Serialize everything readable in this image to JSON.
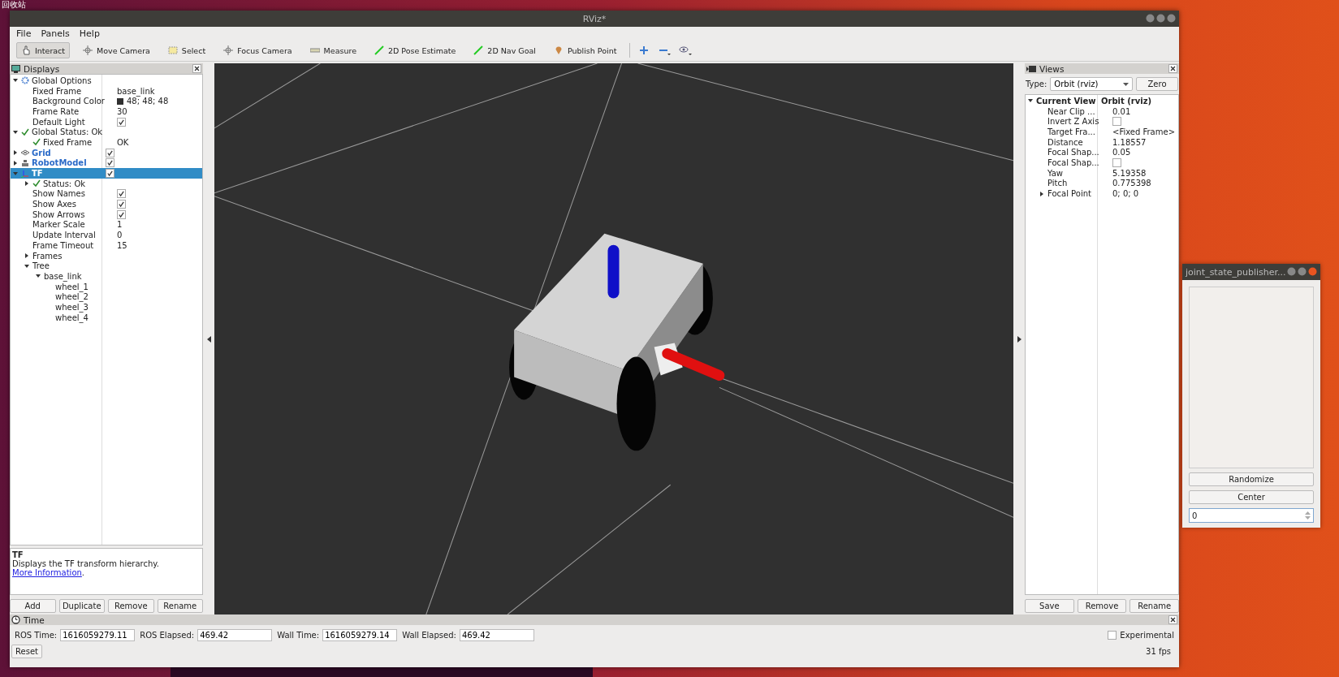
{
  "desktop": {
    "trash_label": "回收站"
  },
  "window": {
    "title": "RViz*"
  },
  "menu": [
    {
      "label": "File"
    },
    {
      "label": "Panels"
    },
    {
      "label": "Help"
    }
  ],
  "tools": [
    {
      "label": "Interact",
      "kind": "interact",
      "selected": true
    },
    {
      "label": "Move Camera",
      "kind": "move",
      "selected": false
    },
    {
      "label": "Select",
      "kind": "select",
      "selected": false
    },
    {
      "label": "Focus Camera",
      "kind": "focus",
      "selected": false
    },
    {
      "label": "Measure",
      "kind": "measure",
      "selected": false
    },
    {
      "label": "2D Pose Estimate",
      "kind": "pose",
      "selected": false
    },
    {
      "label": "2D Nav Goal",
      "kind": "goal",
      "selected": false
    },
    {
      "label": "Publish Point",
      "kind": "point",
      "selected": false
    }
  ],
  "displays": {
    "title": "Displays",
    "tree": [
      {
        "label": "Global Options",
        "kind": "options",
        "expanded": true,
        "selected": false,
        "children": [
          {
            "label": "Fixed Frame",
            "value": "base_link"
          },
          {
            "label": "Background Color",
            "value": "48; 48; 48",
            "color": "#303030"
          },
          {
            "label": "Frame Rate",
            "value": "30"
          },
          {
            "label": "Default Light",
            "checked": true
          }
        ]
      },
      {
        "label": "Global Status: Ok",
        "kind": "status",
        "expanded": true,
        "selected": false,
        "children": [
          {
            "label": "Fixed Frame",
            "kind": "status",
            "value": "OK"
          }
        ]
      },
      {
        "label": "Grid",
        "kind": "grid",
        "expanded": false,
        "selected": false,
        "checked": true
      },
      {
        "label": "RobotModel",
        "kind": "robot",
        "expanded": false,
        "selected": false,
        "checked": true
      },
      {
        "label": "TF",
        "kind": "axes",
        "expanded": true,
        "selected": true,
        "checked": true,
        "children": [
          {
            "label": "Status: Ok",
            "kind": "status",
            "expanded": false
          },
          {
            "label": "Show Names",
            "checked": true
          },
          {
            "label": "Show Axes",
            "checked": true
          },
          {
            "label": "Show Arrows",
            "checked": true
          },
          {
            "label": "Marker Scale",
            "value": "1"
          },
          {
            "label": "Update Interval",
            "value": "0"
          },
          {
            "label": "Frame Timeout",
            "value": "15"
          },
          {
            "label": "Frames",
            "expanded": false
          },
          {
            "label": "Tree",
            "expanded": true,
            "children": [
              {
                "label": "base_link",
                "expanded": true,
                "children": [
                  {
                    "label": "wheel_1"
                  },
                  {
                    "label": "wheel_2"
                  },
                  {
                    "label": "wheel_3"
                  },
                  {
                    "label": "wheel_4"
                  }
                ]
              }
            ]
          }
        ]
      }
    ],
    "description": {
      "title": "TF",
      "text": "Displays the TF transform hierarchy.",
      "link": "More Information",
      "end": "."
    },
    "buttons": [
      "Add",
      "Duplicate",
      "Remove",
      "Rename"
    ]
  },
  "views": {
    "title": "Views",
    "type_label": "Type:",
    "type_value": "Orbit (rviz)",
    "zero": "Zero",
    "current": {
      "label": "Current View",
      "value": "Orbit (rviz)",
      "expanded": true
    },
    "props": [
      {
        "label": "Near Clip ...",
        "value": "0.01"
      },
      {
        "label": "Invert Z Axis",
        "checked": false
      },
      {
        "label": "Target Fra...",
        "value": "<Fixed Frame>"
      },
      {
        "label": "Distance",
        "value": "1.18557"
      },
      {
        "label": "Focal Shap...",
        "value": "0.05"
      },
      {
        "label": "Focal Shap...",
        "checked": false
      },
      {
        "label": "Yaw",
        "value": "5.19358"
      },
      {
        "label": "Pitch",
        "value": "0.775398"
      },
      {
        "label": "Focal Point",
        "value": "0; 0; 0",
        "expanded": false
      }
    ],
    "buttons": [
      "Save",
      "Remove",
      "Rename"
    ]
  },
  "time": {
    "title": "Time",
    "fields": [
      {
        "label": "ROS Time:",
        "value": "1616059279.11"
      },
      {
        "label": "ROS Elapsed:",
        "value": "469.42"
      },
      {
        "label": "Wall Time:",
        "value": "1616059279.14"
      },
      {
        "label": "Wall Elapsed:",
        "value": "469.42"
      }
    ],
    "experimental": {
      "label": "Experimental",
      "checked": false
    },
    "reset": "Reset",
    "fps": "31 fps"
  },
  "joint_window": {
    "title": "joint_state_publisher...",
    "buttons": [
      "Randomize",
      "Center"
    ],
    "value": "0"
  }
}
